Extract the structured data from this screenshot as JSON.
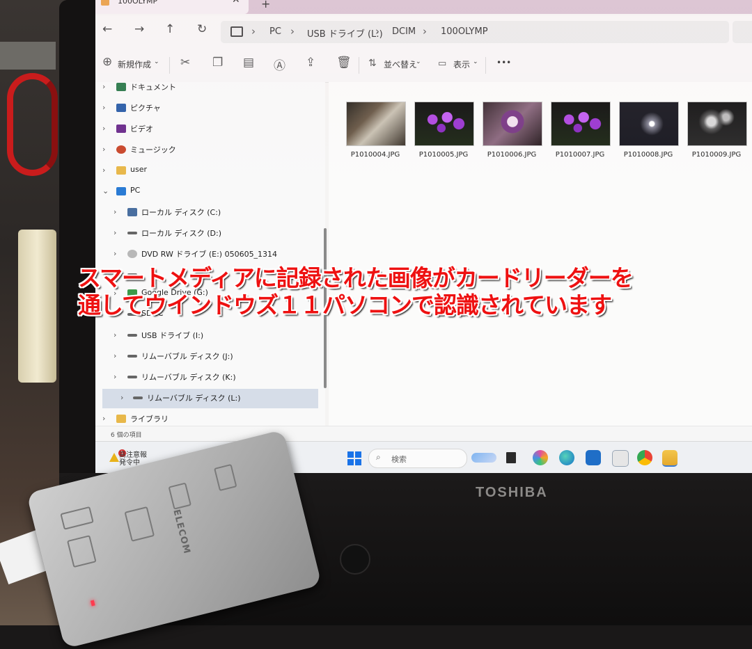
{
  "explorer": {
    "tab_title": "100OLYMP",
    "tab_close": "✕",
    "tab_add": "+",
    "breadcrumbs": [
      "PC",
      "USB ドライブ (L:)",
      "DCIM",
      "100OLYMP"
    ],
    "toolbar": {
      "new_label": "新規作成",
      "sort_label": "並べ替え",
      "view_label": "表示",
      "more_label": "•••"
    },
    "nav_items": [
      {
        "label": "ドキュメント",
        "icon": "documents-icon",
        "color": "#2b7a4b",
        "expanded": false
      },
      {
        "label": "ピクチャ",
        "icon": "pictures-icon",
        "color": "#2b5ea8",
        "expanded": false
      },
      {
        "label": "ビデオ",
        "icon": "videos-icon",
        "color": "#6b2c8c",
        "expanded": false
      },
      {
        "label": "ミュージック",
        "icon": "music-icon",
        "color": "#c9482c",
        "expanded": false
      },
      {
        "label": "user",
        "icon": "folder-icon",
        "color": "#e8b84a",
        "expanded": false
      },
      {
        "label": "PC",
        "icon": "pc-icon",
        "color": "#2a7bd4",
        "expanded": true
      },
      {
        "label": "ローカル ディスク (C:)",
        "icon": "drive-c-icon",
        "color": "#4a6fa0",
        "expanded": false
      },
      {
        "label": "ローカル ディスク (D:)",
        "icon": "drive-icon",
        "color": "#666666",
        "expanded": false
      },
      {
        "label": "DVD RW ドライブ (E:) 050605_1314",
        "icon": "dvd-icon",
        "color": "#b8b8b8",
        "expanded": false
      },
      {
        "label": "",
        "icon": "drive-icon",
        "color": "#666666",
        "expanded": false
      },
      {
        "label": "Google Drive (G:)",
        "icon": "google-drive-icon",
        "color": "#3c9a4a",
        "expanded": false
      },
      {
        "label": "SDHC",
        "icon": "drive-icon",
        "color": "#666666",
        "expanded": false
      },
      {
        "label": "USB ドライブ (I:)",
        "icon": "drive-icon",
        "color": "#666666",
        "expanded": false
      },
      {
        "label": "リムーバブル ディスク (J:)",
        "icon": "drive-icon",
        "color": "#666666",
        "expanded": false
      },
      {
        "label": "リムーバブル ディスク (K:)",
        "icon": "drive-icon",
        "color": "#666666",
        "expanded": false
      },
      {
        "label": "リムーバブル ディスク (L:)",
        "icon": "drive-icon",
        "color": "#666666",
        "expanded": false,
        "selected": true
      },
      {
        "label": "ライブラリ",
        "icon": "library-icon",
        "color": "#e8b84a",
        "expanded": false
      }
    ],
    "files": [
      {
        "name": "P1010004.JPG",
        "theme": "room"
      },
      {
        "name": "P1010005.JPG",
        "theme": "orchid"
      },
      {
        "name": "P1010006.JPG",
        "theme": "orchid-close"
      },
      {
        "name": "P1010007.JPG",
        "theme": "orchid"
      },
      {
        "name": "P1010008.JPG",
        "theme": "dark-light"
      },
      {
        "name": "P1010009.JPG",
        "theme": "dark-flower"
      }
    ],
    "status_text": "6 個の項目"
  },
  "taskbar": {
    "weather_line1": "高注意報",
    "weather_line2": "発令中",
    "badge": "1",
    "search_placeholder": "検索"
  },
  "overlay_caption": {
    "line1": "スマートメディアに記録された画像がカードリーダーを",
    "line2": "通してウインドウズ１１パソコンで認識されています"
  },
  "laptop_brand": "TOSHIBA",
  "reader_brand": "ELECOM",
  "colors": {
    "overlay_text": "#ee1111",
    "accent": "#1a73e8"
  }
}
